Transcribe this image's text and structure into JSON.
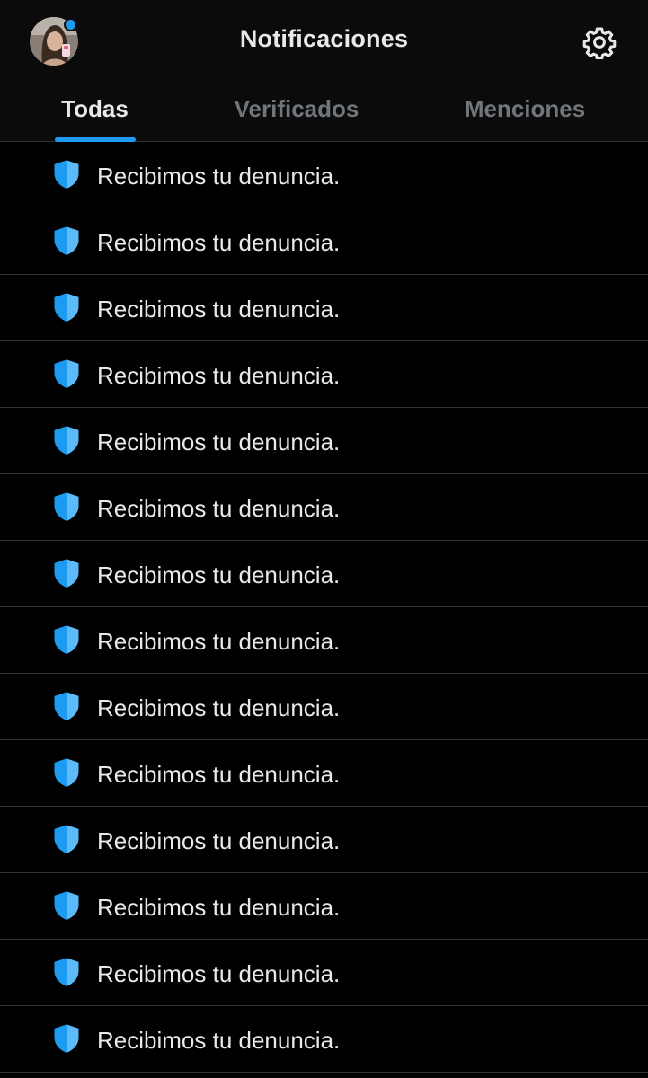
{
  "header": {
    "title": "Notificaciones",
    "avatar": "profile-avatar",
    "settings_icon": "gear-icon",
    "accent_color": "#1d9bf0"
  },
  "tabs": [
    {
      "label": "Todas",
      "active": true
    },
    {
      "label": "Verificados",
      "active": false
    },
    {
      "label": "Menciones",
      "active": false
    }
  ],
  "notifications": [
    {
      "icon": "shield-icon",
      "text": "Recibimos tu denuncia."
    },
    {
      "icon": "shield-icon",
      "text": "Recibimos tu denuncia."
    },
    {
      "icon": "shield-icon",
      "text": "Recibimos tu denuncia."
    },
    {
      "icon": "shield-icon",
      "text": "Recibimos tu denuncia."
    },
    {
      "icon": "shield-icon",
      "text": "Recibimos tu denuncia."
    },
    {
      "icon": "shield-icon",
      "text": "Recibimos tu denuncia."
    },
    {
      "icon": "shield-icon",
      "text": "Recibimos tu denuncia."
    },
    {
      "icon": "shield-icon",
      "text": "Recibimos tu denuncia."
    },
    {
      "icon": "shield-icon",
      "text": "Recibimos tu denuncia."
    },
    {
      "icon": "shield-icon",
      "text": "Recibimos tu denuncia."
    },
    {
      "icon": "shield-icon",
      "text": "Recibimos tu denuncia."
    },
    {
      "icon": "shield-icon",
      "text": "Recibimos tu denuncia."
    },
    {
      "icon": "shield-icon",
      "text": "Recibimos tu denuncia."
    },
    {
      "icon": "shield-icon",
      "text": "Recibimos tu denuncia."
    }
  ]
}
